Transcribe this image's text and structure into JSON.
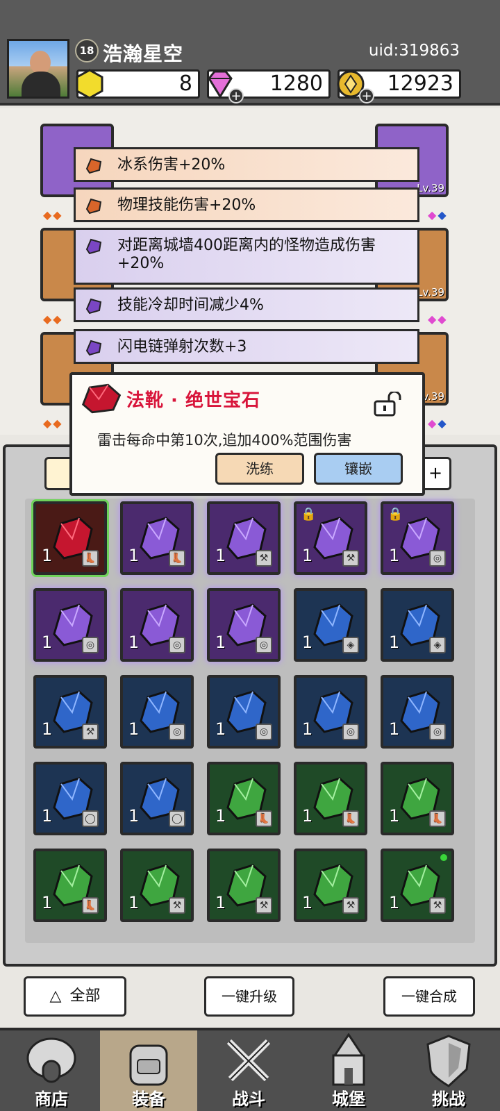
{
  "player": {
    "name": "浩瀚星空",
    "level": "18",
    "uid": "uid:319863"
  },
  "currency": {
    "gold_gem": "8",
    "diamond": "1280",
    "coin": "12923"
  },
  "equipment": {
    "levels": [
      "Lv.39",
      "Lv.39",
      "Lv.39"
    ]
  },
  "affixes": [
    {
      "text": "冰系伤害+20%",
      "color": "orange"
    },
    {
      "text": "物理技能伤害+20%",
      "color": "orange"
    },
    {
      "text": "对距离城墙400距离内的怪物造成伤害+20%",
      "color": "purple"
    },
    {
      "text": "技能冷却时间减少4%",
      "color": "purple"
    },
    {
      "text": "闪电链弹射次数+3",
      "color": "purple"
    }
  ],
  "gem_popup": {
    "title": "法靴 · 绝世宝石",
    "description": "雷击每命中第10次,追加400%范围伤害",
    "refine_label": "洗练",
    "inlay_label": "镶嵌"
  },
  "inventory": {
    "rows": [
      [
        {
          "color": "red",
          "count": "1",
          "slot": "boot",
          "selected": true
        },
        {
          "color": "purple",
          "count": "1",
          "slot": "boot"
        },
        {
          "color": "purple",
          "count": "1",
          "slot": "staff"
        },
        {
          "color": "purple",
          "count": "1",
          "slot": "staff",
          "locked": true
        },
        {
          "color": "purple",
          "count": "1",
          "slot": "ring",
          "locked": true
        }
      ],
      [
        {
          "color": "purple",
          "count": "1",
          "slot": "ring"
        },
        {
          "color": "purple",
          "count": "1",
          "slot": "ring"
        },
        {
          "color": "purple",
          "count": "1",
          "slot": "ring"
        },
        {
          "color": "blue",
          "count": "1",
          "slot": "armor"
        },
        {
          "color": "blue",
          "count": "1",
          "slot": "armor"
        }
      ],
      [
        {
          "color": "blue",
          "count": "1",
          "slot": "staff"
        },
        {
          "color": "blue",
          "count": "1",
          "slot": "ring"
        },
        {
          "color": "blue",
          "count": "1",
          "slot": "ring"
        },
        {
          "color": "blue",
          "count": "1",
          "slot": "ring"
        },
        {
          "color": "blue",
          "count": "1",
          "slot": "ring"
        }
      ],
      [
        {
          "color": "blue",
          "count": "1",
          "slot": "necklace"
        },
        {
          "color": "blue",
          "count": "1",
          "slot": "necklace"
        },
        {
          "color": "green",
          "count": "1",
          "slot": "boot"
        },
        {
          "color": "green",
          "count": "1",
          "slot": "boot"
        },
        {
          "color": "green",
          "count": "1",
          "slot": "boot"
        }
      ],
      [
        {
          "color": "green",
          "count": "1",
          "slot": "boot"
        },
        {
          "color": "green",
          "count": "1",
          "slot": "staff"
        },
        {
          "color": "green",
          "count": "1",
          "slot": "staff"
        },
        {
          "color": "green",
          "count": "1",
          "slot": "staff"
        },
        {
          "color": "green",
          "count": "1",
          "slot": "staff",
          "new": true
        }
      ]
    ]
  },
  "actions": {
    "all_label": "全部",
    "upgrade_label": "一键升级",
    "merge_label": "一键合成"
  },
  "nav": {
    "shop": "商店",
    "equipment": "装备",
    "battle": "战斗",
    "castle": "城堡",
    "challenge": "挑战"
  },
  "colors": {
    "header_bg": "#5a5a5a",
    "accent_red": "#d8143a",
    "refine_btn": "#f6d9b5",
    "inlay_btn": "#a9cdf2"
  }
}
